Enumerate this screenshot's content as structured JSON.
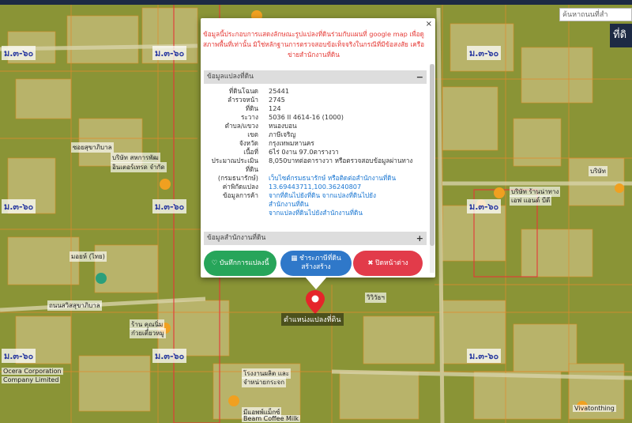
{
  "map": {
    "search_placeholder": "ค้นหาถนนที่สำ",
    "side_button": "ที่ดิ",
    "zone_label": "ม.๓-๖๐",
    "place_labels": [
      "บริษัท สหการพัฒ",
      "อินเตอร์เทรด จำกัด",
      "ซอยสุขาภิบาล",
      "ถนนสวิสสุขาภิบาล",
      "มอยห์ (ไทย)",
      "ร้าน คุณนิ่ม",
      "ก๋วยเตี๋ยวหมู",
      "Ocera Corporation",
      "Company Limited",
      "โรงงานผลิต และ",
      "จำหน่ายกระจก",
      "มีแอพพ์แม็กซ์",
      "Beam Coffee Milk",
      "บริษัท ร้านน่าทาง",
      "เอฟ แอนด์ บีตี",
      "วิวิวัธฯ",
      "บริษัท",
      "Vivatonthing"
    ]
  },
  "popup": {
    "close": "×",
    "disclaimer": "ข้อมูลนี้ประกอบการแสดงลักษณะรูปแปลงที่ดินร่วมกับแผนที่ google map เพื่อดูสภาพพื้นที่เท่านั้น มิใช่หลักฐานการตรวจสอบข้อเท็จจริงในกรณีที่มีข้อสงสัย เครือข่ายสำนักงานที่ดิน",
    "section1": {
      "title": "ข้อมูลแปลงที่ดิน",
      "toggle": "−"
    },
    "fields": [
      {
        "label": "ที่ดินโฉนด",
        "value": "25441"
      },
      {
        "label": "ลำรวจหน้า",
        "value": "2745"
      },
      {
        "label": "ที่ดิน",
        "value": "124"
      },
      {
        "label": "ระวาง",
        "value": "5036 II 4614-16 (1000)"
      },
      {
        "label": "ตำบล/แขวง",
        "value": "หนองบอน"
      },
      {
        "label": "เขต",
        "value": "ภาษีเจริญ"
      },
      {
        "label": "จังหวัด",
        "value": "กรุงเทพมหานคร"
      },
      {
        "label": "เนื้อที่",
        "value": "6ไร่ 0งาน 97.0ตารางวา"
      },
      {
        "label": "ประมาณประเมินที่ดิน",
        "value": "8,050บาทต่อตารางวา หรือตรวจสอบข้อมูลผ่านทาง"
      },
      {
        "label": "(กรมธนารักษ์)",
        "value": "เว็บไซต์กรมธนารักษ์ หรือติดต่อสำนักงานที่ดิน",
        "link": true
      },
      {
        "label": "ค่าพิกัดแปลง",
        "value": "13.69443711,100.36240807",
        "link": true
      },
      {
        "label": "ข้อมูลการค้า",
        "value": "จากที่ดินไปยังที่ดิน จากแปลงที่ดินไปยัง",
        "link": true
      },
      {
        "label": "",
        "value": "สำนักงานที่ดิน",
        "link": true
      },
      {
        "label": "",
        "value": "จากแปลงที่ดินไปยังสำนักงานที่ดิน",
        "link": true
      }
    ],
    "section2": {
      "title": "ข้อมูลสำนักงานที่ดิน",
      "toggle": "+"
    },
    "buttons": {
      "save": "♡ บันทึกการแปลงนี้",
      "pay_line1": "▦ ชำระภาษีที่ดิน",
      "pay_line2": "สร้างสร้าง",
      "close": "✖ ปิดหน้าต่าง"
    }
  },
  "marker": {
    "label": "ตำแหน่งแปลงที่ดิน"
  }
}
